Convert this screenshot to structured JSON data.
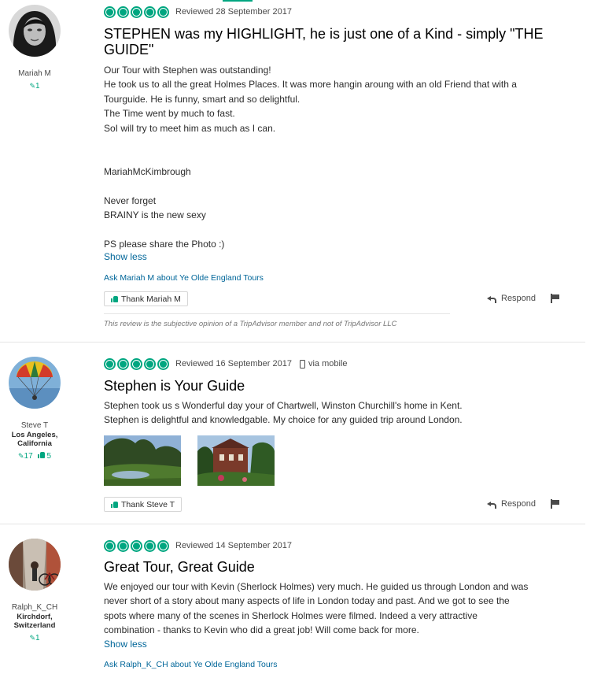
{
  "reviews": [
    {
      "member": {
        "name": "Mariah M",
        "location": "",
        "review_count": "1",
        "helpful_count": ""
      },
      "bubbles": 5,
      "date": "Reviewed 28 September 2017",
      "via": "",
      "title": "STEPHEN was my HIGHLIGHT, he is just one of a Kind - simply \"THE GUIDE\"",
      "body": [
        "Our Tour with Stephen was outstanding!",
        "He took us to all the great Holmes Places. It was more hangin aroung with an old Friend that with a Tourguide. He is funny, smart and so delightful.",
        "The Time went by much to fast.",
        "SoI will try to meet him as much as I can.",
        "",
        "",
        "MariahMcKimbrough",
        "",
        "Never forget",
        "BRAINY is the new sexy",
        "",
        "PS please share the Photo :)"
      ],
      "show_less": "Show less",
      "ask": "Ask Mariah M about Ye Olde England Tours",
      "thank": "Thank Mariah M",
      "respond": "Respond",
      "disclaimer": "This review is the subjective opinion of a TripAdvisor member and not of TripAdvisor LLC"
    },
    {
      "member": {
        "name": "Steve T",
        "location": "Los Angeles, California",
        "review_count": "17",
        "helpful_count": "5"
      },
      "bubbles": 5,
      "date": "Reviewed 16 September 2017",
      "via": "via mobile",
      "title": "Stephen is Your Guide",
      "body": [
        "Stephen took us s Wonderful day your of Chartwell, Winston Churchill's home in Kent. Stephen is delightful and knowledgable. My choice for any guided trip around London."
      ],
      "thank": "Thank Steve T",
      "respond": "Respond"
    },
    {
      "member": {
        "name": "Ralph_K_CH",
        "location": "Kirchdorf, Switzerland",
        "review_count": "1",
        "helpful_count": ""
      },
      "bubbles": 5,
      "date": "Reviewed 14 September 2017",
      "via": "",
      "title": "Great Tour, Great Guide",
      "body": [
        "We enjoyed our tour with Kevin (Sherlock Holmes) very much. He guided us through London and was never short of a story about many aspects of life in London today and past. And we got to see the spots where many of the scenes in Sherlock Holmes were filmed. Indeed a very attractive combination - thanks to Kevin who did a great job! Will come back for more."
      ],
      "show_less": "Show less",
      "ask": "Ask Ralph_K_CH about Ye Olde England Tours"
    }
  ],
  "colors": {
    "accent": "#00a680",
    "link": "#006699"
  }
}
